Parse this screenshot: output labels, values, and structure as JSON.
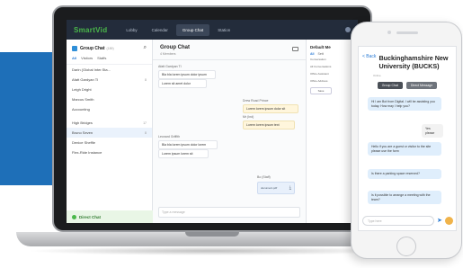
{
  "app": {
    "logo": "SmartVid",
    "nav": [
      "Lobby",
      "Calendar",
      "Group Chat",
      "Station"
    ],
    "active_nav": "Group Chat"
  },
  "left": {
    "title": "Group Chat",
    "title_badge": "(189)",
    "filters": [
      "All",
      "Visitors",
      "Staffs"
    ],
    "contacts_top": [
      {
        "name": "Darin (Global Inter.Sta...",
        "badge": ""
      },
      {
        "name": "Afatt Gardyan TI",
        "badge": "8"
      },
      {
        "name": "Leigh Dright",
        "badge": ""
      },
      {
        "name": "Marcus Smith",
        "badge": ""
      },
      {
        "name": "Accounting",
        "badge": ""
      }
    ],
    "contacts_bottom": [
      {
        "name": "High Bridges",
        "badge": "17"
      },
      {
        "name": "Bruno Seven",
        "badge": "8"
      },
      {
        "name": "Denice Sheffle",
        "badge": ""
      },
      {
        "name": "Flex-Ride Instance",
        "badge": ""
      }
    ],
    "direct_chat": "Direct Chat"
  },
  "chat": {
    "title": "Group Chat",
    "subtitle": "4 Members",
    "messages": [
      {
        "who": "Afatt Gardyan TI",
        "text": "Bla bla lorem ipsum dolor ipsum",
        "me": false
      },
      {
        "who": "",
        "text": "Lorem sit amet dolor",
        "me": false
      },
      {
        "who": "Drew Road Prince",
        "text": "Lorem lorem ipsum dolor sit",
        "me": true
      },
      {
        "who": "Mr (Ind)",
        "text": "Lorem lorem ipsum text",
        "me": true
      },
      {
        "who": "Leonard Griffith",
        "text": "Bla bla lorem ipsum dolor lorem",
        "me": false
      },
      {
        "who": "",
        "text": "Lorem ipsum lorem sit",
        "me": false
      },
      {
        "who": "Bo (Staff)",
        "text": "",
        "me": true
      }
    ],
    "file_label": "document.pdf",
    "composer_placeholder": "Type a message"
  },
  "right": {
    "title": "Default Me",
    "tabs": [
      "All",
      "Sett"
    ],
    "rows": [
      "Conversation",
      "All Conversations",
      "Office Assistant",
      "Office Address"
    ],
    "button": "Save"
  },
  "phone": {
    "back": "< Back",
    "title": "Buckinghamshire New University (BUCKS)",
    "subtitle": "Online",
    "btn1": "Group Chat",
    "btn2": "Direct Message",
    "messages": [
      {
        "text": "Hi I am Bot from Digital. I will be assisting you today. How may I help you?",
        "me": false
      },
      {
        "text": "Yes please",
        "me": true
      },
      {
        "text": "Hello if you are a guest or visitor to the site please use the form",
        "me": false
      },
      {
        "text": "Is there a parking space reserved?",
        "me": false
      },
      {
        "text": "Is it possible to arrange a meeting with the team?",
        "me": false
      }
    ],
    "input_placeholder": "Type here"
  }
}
